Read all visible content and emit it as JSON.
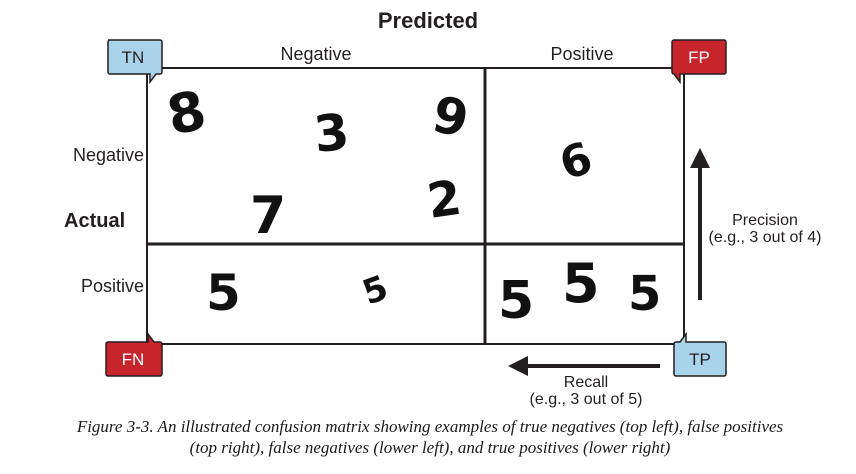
{
  "diagram": {
    "title": "Predicted",
    "columns": {
      "negative": "Negative",
      "positive": "Positive"
    },
    "rows": {
      "axis_label": "Actual",
      "negative": "Negative",
      "positive": "Positive"
    },
    "badges": {
      "tn": {
        "label": "TN",
        "color": "#a9d3ea"
      },
      "fp": {
        "label": "FP",
        "color": "#c8242b"
      },
      "fn": {
        "label": "FN",
        "color": "#c8242b"
      },
      "tp": {
        "label": "TP",
        "color": "#a9d3ea"
      }
    },
    "cells": {
      "top_left": [
        "8",
        "3",
        "9",
        "7",
        "2"
      ],
      "top_right": [
        "6"
      ],
      "bottom_left": [
        "5",
        "5"
      ],
      "bottom_right": [
        "5",
        "5",
        "5"
      ]
    },
    "precision": {
      "label": "Precision",
      "example": "(e.g., 3 out of 4)"
    },
    "recall": {
      "label": "Recall",
      "example": "(e.g., 3 out of 5)"
    }
  },
  "caption": {
    "line1": "Figure 3-3. An illustrated confusion matrix showing examples of true negatives (top left), false positives",
    "line2": "(top right), false negatives (lower left), and true positives (lower right)"
  }
}
